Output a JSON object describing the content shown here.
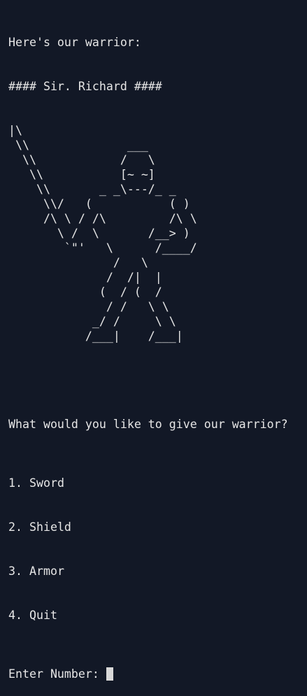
{
  "terminal": {
    "intro": "Here's our warrior:",
    "name_banner": "#### Sir. Richard ####",
    "ascii_art": "|\\\n \\\\              ___\n  \\\\            /   \\\n   \\\\           [~ ~]\n    \\\\       _ _\\---/_ _\n     \\\\/   (           ( )\n     /\\ \\ / /\\         /\\ \\\n       \\ /  \\       /__> )\n        `\"'   \\      /____/\n               /   \\\n              /  /|  |\n             (  / (  /\n              / /   \\ \\\n            _/ /     \\ \\\n           /___|    /___|",
    "question": "What would you like to give our warrior?",
    "options": [
      {
        "number": "1.",
        "label": "Sword"
      },
      {
        "number": "2.",
        "label": "Shield"
      },
      {
        "number": "3.",
        "label": "Armor"
      },
      {
        "number": "4.",
        "label": "Quit"
      }
    ],
    "prompt": "Enter Number: ",
    "input_value": ""
  },
  "colors": {
    "background": "#121826",
    "text": "#e6e6e6",
    "cursor": "#d8d8d8"
  }
}
